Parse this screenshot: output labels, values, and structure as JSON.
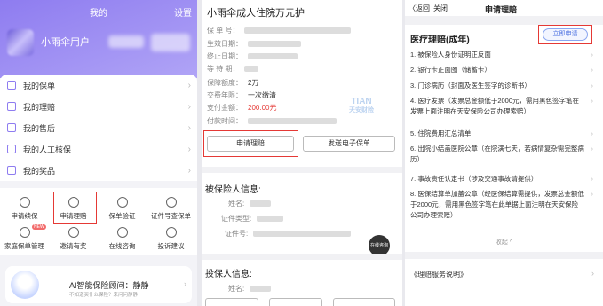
{
  "p1": {
    "title": "我的",
    "settings": "设置",
    "username": "小雨伞用户",
    "menu": [
      {
        "label": "我的保单"
      },
      {
        "label": "我的理赔"
      },
      {
        "label": "我的售后"
      },
      {
        "label": "我的人工核保"
      },
      {
        "label": "我的奖品"
      }
    ],
    "grid": [
      {
        "label": "申请续保",
        "icon": "renew-icon"
      },
      {
        "label": "申请理赔",
        "icon": "claim-icon"
      },
      {
        "label": "保单验证",
        "icon": "verify-icon"
      },
      {
        "label": "证件号查保单",
        "icon": "id-search-icon"
      },
      {
        "label": "家庭保单管理",
        "icon": "family-icon"
      },
      {
        "label": "邀请有奖",
        "icon": "gift-icon"
      },
      {
        "label": "在线咨询",
        "icon": "chat-icon"
      },
      {
        "label": "投诉建议",
        "icon": "feedback-icon"
      }
    ],
    "new_badge": "NEW",
    "ai_title": "AI智能保险顾问：静静",
    "ai_sub": "不知道买什么保险？来问问静静"
  },
  "p2": {
    "title": "小雨伞成人住院万元护",
    "fields": {
      "policy_no": "保 单 号：",
      "effective": "生效日期：",
      "expiry": "终止日期：",
      "waiting": "等 待 期：",
      "coverage_label": "保障额度：",
      "coverage": "2万",
      "pay_label": "交费年限：",
      "pay": "一次缴清",
      "amount_label": "支付金额：",
      "amount": "200.00元",
      "paytime_label": "付款时间："
    },
    "watermark_1": "TIAN",
    "watermark_2": "天安财险",
    "btn_claim": "申请理赔",
    "btn_email": "发送电子保单",
    "insured_title": "被保险人信息:",
    "insured_name": "姓名:",
    "insured_idtype": "证件类型:",
    "insured_idno": "证件号:",
    "holder_title": "投保人信息:",
    "holder_name": "姓名:",
    "fab": "在线咨询"
  },
  "p3": {
    "back": "〈返回",
    "close": "关闭",
    "title": "申请理赔",
    "section": "医疗理赔(成年)",
    "apply": "立即申请",
    "items": [
      "1. 被保险人身份证明正反面",
      "2. 银行卡正面图（储蓄卡）",
      "3. 门诊病历（封面及医生签字的诊断书）",
      "4. 医疗发票（发票总金额低于2000元，需用黑色签字笔在发票上面注明在天安保险公司办理索赔）",
      "5. 住院费用汇总清单",
      "6. 出院小结盖医院公章（在院满七天，若病情复杂需完整病历）",
      "7. 事故责任认定书（涉及交通事故请提供）",
      "8. 医保结算单加盖公章（经医保结算需提供，发票总金额低于2000元，需用黑色签字笔在此单据上面注明在天安保险公司办理索赔）"
    ],
    "collapse": "收起 ^",
    "service": "《理赔服务说明》"
  }
}
